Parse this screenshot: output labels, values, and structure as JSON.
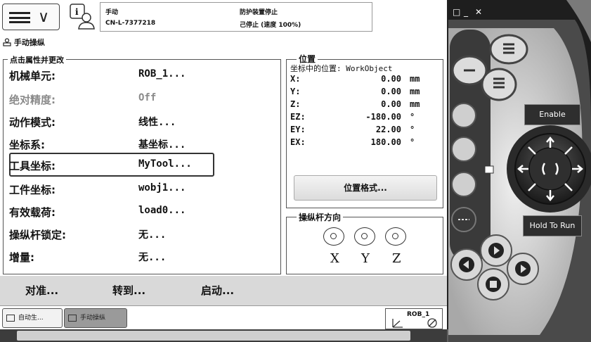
{
  "status": {
    "mode": "手动",
    "controller_id": "CN-L-7377218",
    "safety": "防护装置停止",
    "state": "己停止 (速度 100%)"
  },
  "app": {
    "title": "手动操纵"
  },
  "props": {
    "legend": "点击属性并更改",
    "rows": [
      {
        "label": "机械单元:",
        "value": "ROB_1..."
      },
      {
        "label": "绝对精度:",
        "value": "Off"
      },
      {
        "label": "动作模式:",
        "value": "线性..."
      },
      {
        "label": "坐标系:",
        "value": "基坐标..."
      },
      {
        "label": "工具坐标:",
        "value": "MyTool..."
      },
      {
        "label": "工件坐标:",
        "value": "wobj1..."
      },
      {
        "label": "有效载荷:",
        "value": "load0..."
      },
      {
        "label": "操纵杆锁定:",
        "value": "无..."
      },
      {
        "label": "增量:",
        "value": "无..."
      }
    ]
  },
  "position": {
    "legend": "位置",
    "subtitle": "坐标中的位置: WorkObject",
    "coords": [
      {
        "axis": "X:",
        "value": "0.00",
        "unit": "mm"
      },
      {
        "axis": "Y:",
        "value": "0.00",
        "unit": "mm"
      },
      {
        "axis": "Z:",
        "value": "0.00",
        "unit": "mm"
      },
      {
        "axis": "EZ:",
        "value": "-180.00",
        "unit": "°"
      },
      {
        "axis": "EY:",
        "value": "22.00",
        "unit": "°"
      },
      {
        "axis": "EX:",
        "value": "180.00",
        "unit": "°"
      }
    ],
    "format_button": "位置格式..."
  },
  "joystick": {
    "legend": "操纵杆方向",
    "labels": [
      "X",
      "Y",
      "Z"
    ]
  },
  "actions": {
    "align": "对准...",
    "goto": "转到...",
    "start": "启动..."
  },
  "taskbar": {
    "auto": "自动生...",
    "jog": "手动操纵",
    "robot": "ROB_1"
  },
  "pendant": {
    "enable": "Enable",
    "hold": "Hold To Run"
  }
}
